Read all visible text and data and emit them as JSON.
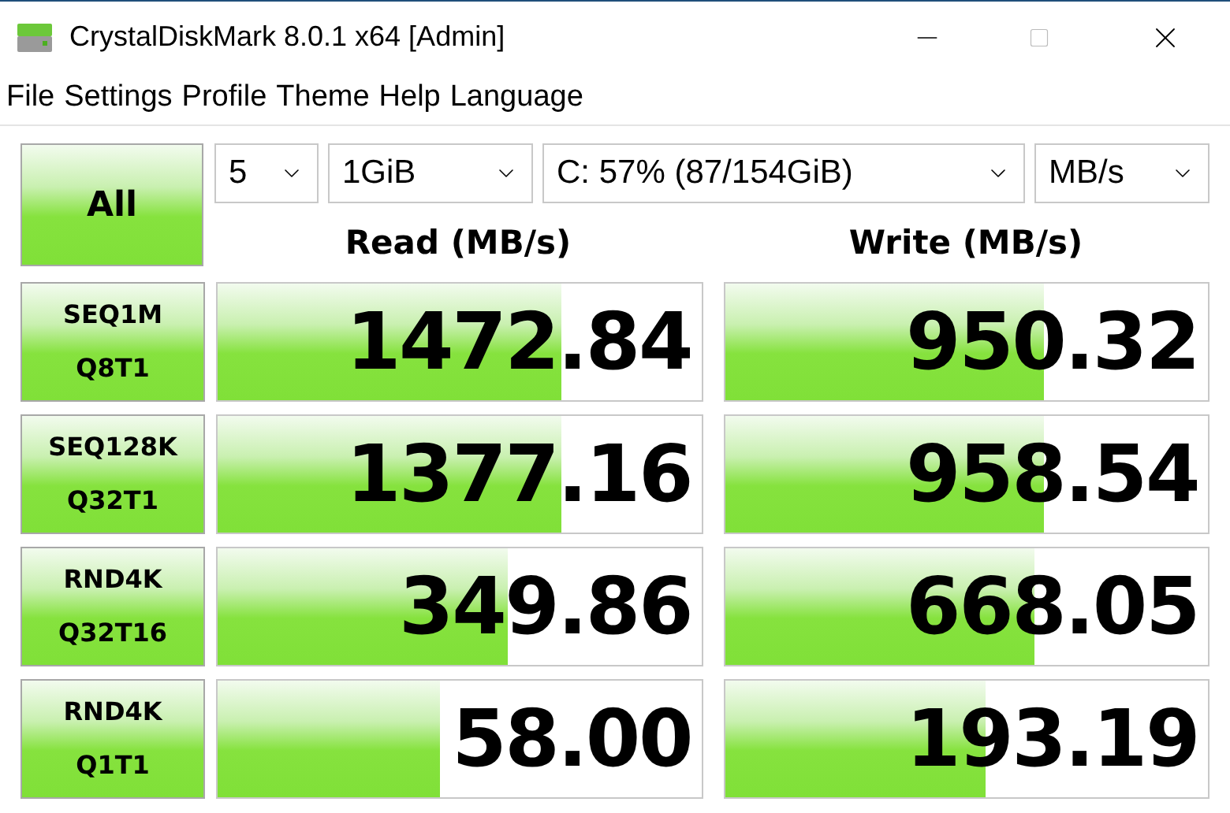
{
  "window": {
    "title": "CrystalDiskMark 8.0.1 x64 [Admin]"
  },
  "menu": [
    "File",
    "Settings",
    "Profile",
    "Theme",
    "Help",
    "Language"
  ],
  "all_button": "All",
  "selects": [
    {
      "value": "5",
      "kind": "count"
    },
    {
      "value": "1GiB",
      "kind": "size"
    },
    {
      "value": "C: 57% (87/154GiB)",
      "kind": "drive"
    },
    {
      "value": "MB/s",
      "kind": "unit"
    }
  ],
  "headers": [
    "Read (MB/s)",
    "Write (MB/s)"
  ],
  "rows": [
    {
      "label": "SEQ1M",
      "sublabel": "Q8T1",
      "read": {
        "value": "1472.84",
        "level": 0.71
      },
      "write": {
        "value": "950.32",
        "level": 0.66
      }
    },
    {
      "label": "SEQ128K",
      "sublabel": "Q32T1",
      "read": {
        "value": "1377.16",
        "level": 0.71
      },
      "write": {
        "value": "958.54",
        "level": 0.66
      }
    },
    {
      "label": "RND4K",
      "sublabel": "Q32T16",
      "read": {
        "value": "349.86",
        "level": 0.6
      },
      "write": {
        "value": "668.05",
        "level": 0.64
      }
    },
    {
      "label": "RND4K",
      "sublabel": "Q1T1",
      "read": {
        "value": "58.00",
        "level": 0.46
      },
      "write": {
        "value": "193.19",
        "level": 0.54
      }
    }
  ]
}
